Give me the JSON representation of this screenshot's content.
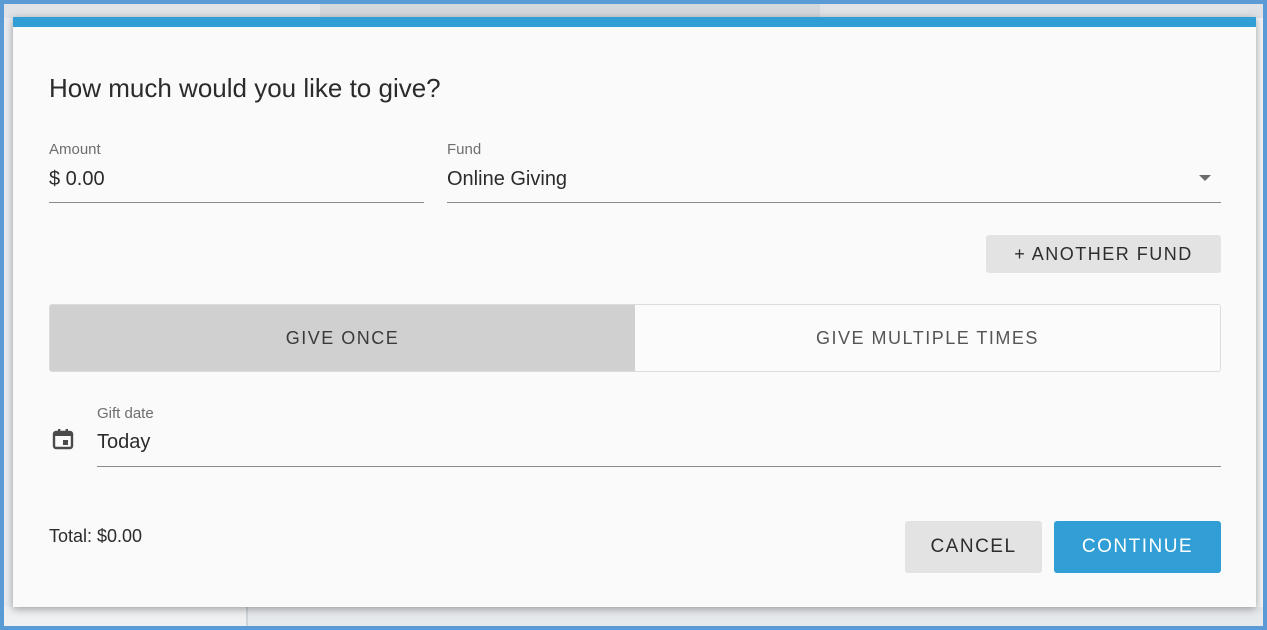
{
  "dialog": {
    "title": "How much would you like to give?",
    "accent_color": "#319fd6"
  },
  "amount": {
    "label": "Amount",
    "value": "$ 0.00"
  },
  "fund": {
    "label": "Fund",
    "selected": "Online Giving",
    "icon": "dropdown-arrow-icon"
  },
  "another_fund_button": {
    "label": "+ ANOTHER FUND"
  },
  "frequency": {
    "options": [
      {
        "label": "GIVE ONCE",
        "selected": true
      },
      {
        "label": "GIVE MULTIPLE TIMES",
        "selected": false
      }
    ]
  },
  "gift_date": {
    "label": "Gift date",
    "value": "Today",
    "icon": "calendar-icon"
  },
  "total": {
    "text": "Total: $0.00"
  },
  "actions": {
    "cancel_label": "CANCEL",
    "continue_label": "CONTINUE"
  }
}
